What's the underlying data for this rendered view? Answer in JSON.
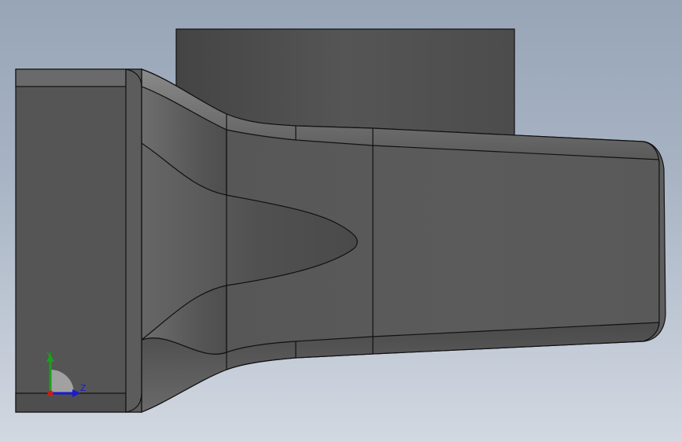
{
  "viewport": {
    "background_top": "#97a5b7",
    "background_bottom": "#d2d8e1",
    "model_color": "#5a5a5a"
  },
  "triad": {
    "y_label": "Y",
    "z_label": "Z",
    "y_color": "#1aa01a",
    "z_color": "#1a1ad0",
    "x_color": "#d01a1a"
  }
}
